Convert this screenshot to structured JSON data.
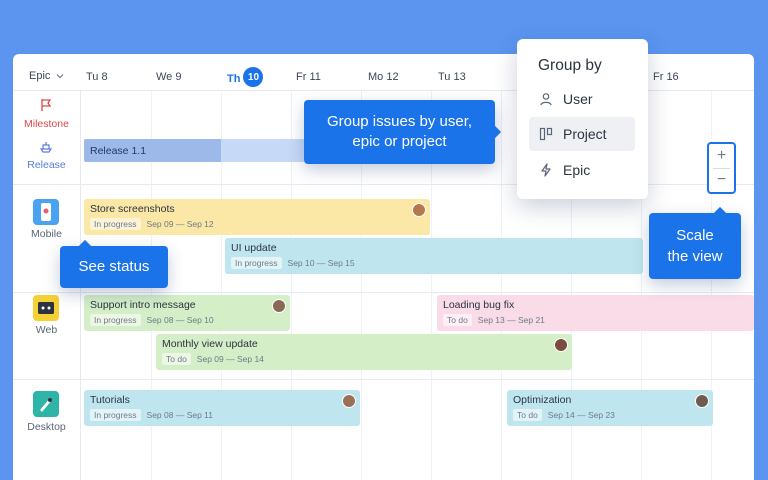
{
  "toolbar": {
    "epic_select": "Epic"
  },
  "days": [
    {
      "label": "Tu 8"
    },
    {
      "label": "We 9"
    },
    {
      "label": "Th",
      "badge": "10",
      "today": true
    },
    {
      "label": "Fr 11"
    },
    {
      "label": "Mo 12"
    },
    {
      "label": "Tu 13"
    },
    {
      "label": "Fr 16"
    }
  ],
  "left_rows": {
    "milestone": "Milestone",
    "release": "Release",
    "mobile": "Mobile",
    "web": "Web",
    "desktop": "Desktop"
  },
  "release_bar": {
    "label": "Release 1.1"
  },
  "tasks": {
    "store_screenshots": {
      "title": "Store screenshots",
      "status": "In progress",
      "dates": "Sep 09 — Sep 12"
    },
    "ui_update": {
      "title": "UI update",
      "status": "In progress",
      "dates": "Sep 10 — Sep 15"
    },
    "support_intro": {
      "title": "Support intro message",
      "status": "In progress",
      "dates": "Sep 08 — Sep 10"
    },
    "loading_bug": {
      "title": "Loading bug fix",
      "status": "To do",
      "dates": "Sep 13 — Sep 21"
    },
    "monthly_view": {
      "title": "Monthly view update",
      "status": "To do",
      "dates": "Sep 09 — Sep 14"
    },
    "tutorials": {
      "title": "Tutorials",
      "status": "In progress",
      "dates": "Sep 08 — Sep 11"
    },
    "optimization": {
      "title": "Optimization",
      "status": "To do",
      "dates": "Sep 14 — Sep 23"
    }
  },
  "callouts": {
    "group_issues_line1": "Group issues by user,",
    "group_issues_line2": "epic or project",
    "see_status": "See status",
    "scale_line1": "Scale",
    "scale_line2": "the view"
  },
  "group_by": {
    "heading": "Group by",
    "items": [
      {
        "label": "User",
        "icon": "user-icon"
      },
      {
        "label": "Project",
        "icon": "project-icon",
        "selected": true
      },
      {
        "label": "Epic",
        "icon": "epic-icon"
      }
    ]
  },
  "zoom": {
    "plus": "+",
    "minus": "−"
  },
  "colors": {
    "background": "#5b95f0",
    "accent": "#1a73e8",
    "yellow_bar": "#fbe7a6",
    "cyan_bar": "#bfe6ef",
    "green_bar": "#d4eec7",
    "pink_bar": "#fadbe8",
    "milestone": "#e04848"
  }
}
